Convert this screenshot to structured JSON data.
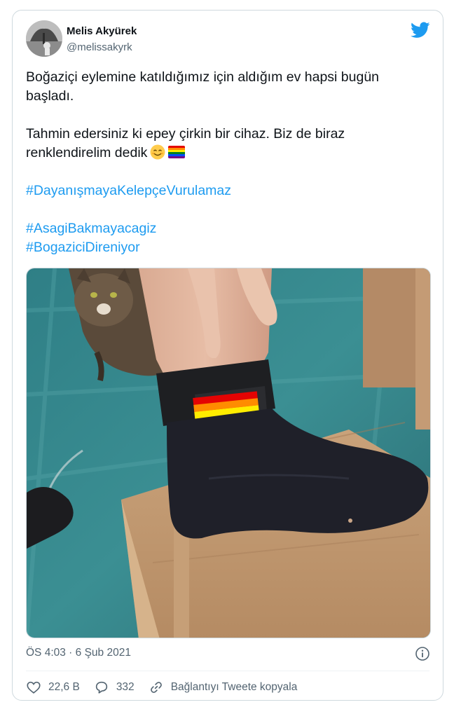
{
  "author": {
    "name": "Melis Akyürek",
    "handle": "@melissakyrk"
  },
  "tweet": {
    "paragraph1_line1": "Boğaziçi eylemine katıldığımız için aldığım ev hapsi bugün",
    "paragraph1_line2": "başladı.",
    "paragraph2_line1": "Tahmin edersiniz ki epey çirkin bir cihaz. Biz de biraz",
    "paragraph2_line2": "renklendirelim dedik",
    "emoji_1": "smiling-face-emoji",
    "emoji_2": "rainbow-flag-emoji",
    "hashtags": [
      "#DayanışmayaKelepçeVurulamaz",
      "#AsagiBakmayacagiz",
      "#BogaziciDireniyor"
    ]
  },
  "timestamp": "ÖS 4:03 · 6 Şub 2021",
  "actions": {
    "likes": "22,6 B",
    "replies": "332",
    "copy_link": "Bağlantıyı Tweete kopyala"
  },
  "colors": {
    "accent": "#1d9bf0",
    "text": "#0f1419",
    "muted": "#536471",
    "border": "#cfd9de"
  },
  "icons": [
    "twitter-bird-icon",
    "info-icon",
    "heart-icon",
    "reply-icon",
    "link-icon"
  ]
}
